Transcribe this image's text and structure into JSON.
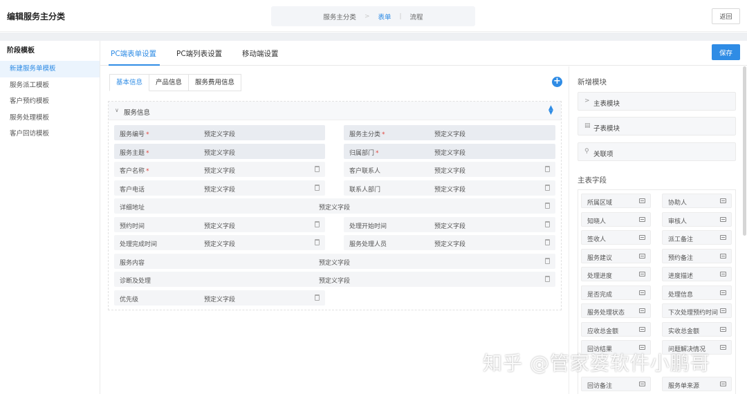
{
  "header": {
    "title": "编辑服务主分类",
    "steps": [
      "服务主分类",
      "表单",
      "流程"
    ],
    "back_label": "返回"
  },
  "sidebar": {
    "title": "阶段模板",
    "items": [
      "新建服务单模板",
      "服务派工模板",
      "客户预约模板",
      "服务处理模板",
      "客户回访模板"
    ]
  },
  "main": {
    "tabs": [
      "PC端表单设置",
      "PC端列表设置",
      "移动端设置"
    ],
    "save_label": "保存",
    "sub_tabs": [
      "基本信息",
      "产品信息",
      "服务费用信息"
    ],
    "section_title": "服务信息",
    "placeholder": "预定义字段",
    "fields": {
      "service_no": "服务编号",
      "service_main_category": "服务主分类",
      "service_subject": "服务主题",
      "owner_dept": "归属部门",
      "customer_name": "客户名称",
      "customer_contact": "客户联系人",
      "customer_phone": "客户电话",
      "contact_dept": "联系人部门",
      "address": "详细地址",
      "appointment_time": "预约时间",
      "process_start_time": "处理开始时间",
      "process_finish_time": "处理完成时间",
      "service_handler": "服务处理人员",
      "service_content": "服务内容",
      "diagnosis": "诊断及处理",
      "priority": "优先级"
    }
  },
  "right_panel": {
    "new_module_title": "新增模块",
    "modules": [
      "主表模块",
      "子表模块",
      "关联项"
    ],
    "main_fields_title": "主表字段",
    "fields": [
      "所属区域",
      "协助人",
      "知晓人",
      "审核人",
      "签收人",
      "派工备注",
      "服务建议",
      "预约备注",
      "处理进度",
      "进度描述",
      "是否完成",
      "处理信息",
      "服务处理状态",
      "下次处理预约时间",
      "应收总金额",
      "实收总金额",
      "回访结果",
      "问题解决情况",
      "回访备注",
      "服务单来源"
    ]
  },
  "watermark": "知乎 @管家婆软件小鹏哥",
  "colors": {
    "accent": "#2f8ce5",
    "required": "#e0463e"
  }
}
